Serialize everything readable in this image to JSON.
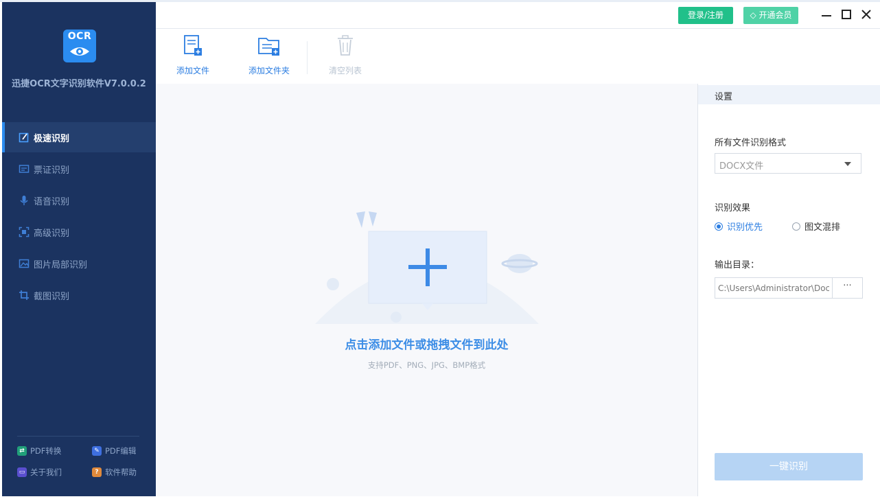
{
  "app": {
    "title": "迅捷OCR文字识别软件V7.0.0.2",
    "logo_text": "OCR"
  },
  "sidebar": {
    "items": [
      {
        "label": "极速识别",
        "icon": "fast-ocr-icon",
        "active": true
      },
      {
        "label": "票证识别",
        "icon": "ticket-icon",
        "active": false
      },
      {
        "label": "语音识别",
        "icon": "microphone-icon",
        "active": false
      },
      {
        "label": "高级识别",
        "icon": "scan-frame-icon",
        "active": false
      },
      {
        "label": "图片局部识别",
        "icon": "image-icon",
        "active": false
      },
      {
        "label": "截图识别",
        "icon": "crop-icon",
        "active": false
      }
    ],
    "footer": [
      {
        "label": "PDF转换",
        "icon": "pdf-convert-icon",
        "color": "#21a07a"
      },
      {
        "label": "PDF编辑",
        "icon": "pdf-edit-icon",
        "color": "#3e6fe0"
      },
      {
        "label": "关于我们",
        "icon": "about-icon",
        "color": "#5a4fcf"
      },
      {
        "label": "软件帮助",
        "icon": "help-icon",
        "color": "#e08a3c"
      }
    ]
  },
  "header": {
    "login_label": "登录/注册",
    "vip_label": "开通会员",
    "vip_icon": "diamond-icon"
  },
  "toolbar": {
    "add_file": "添加文件",
    "add_folder": "添加文件夹",
    "clear_list": "清空列表"
  },
  "drop_area": {
    "title": "点击添加文件或拖拽文件到此处",
    "subtitle": "支持PDF、PNG、JPG、BMP格式"
  },
  "settings": {
    "title": "设置",
    "format_label": "所有文件识别格式",
    "format_value": "DOCX文件",
    "effect_label": "识别效果",
    "effect_options": [
      "识别优先",
      "图文混排"
    ],
    "effect_selected": "识别优先",
    "output_label": "输出目录：",
    "output_path": "C:\\Users\\Administrator\\Docu",
    "browse_label": "···",
    "run_label": "一键识别"
  },
  "colors": {
    "sidebar_bg": "#1b3360",
    "accent": "#2b7de1",
    "login_btn": "#21c08a",
    "vip_btn": "#4fd2a6"
  }
}
